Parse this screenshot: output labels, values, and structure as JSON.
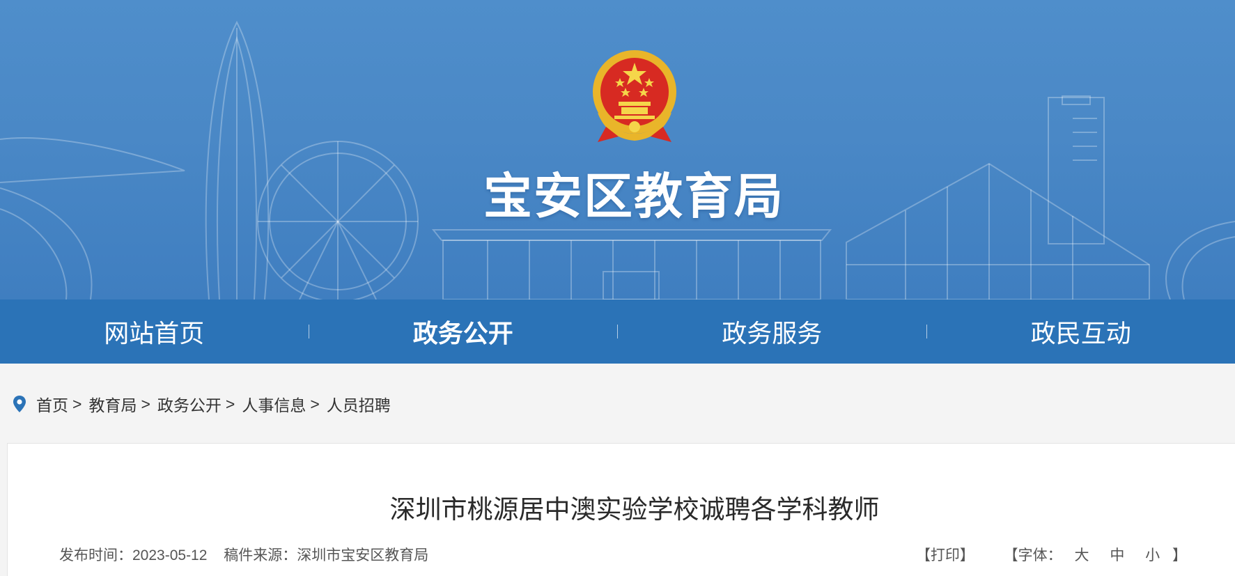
{
  "header": {
    "site_title": "宝安区教育局",
    "emblem": "national-emblem"
  },
  "nav": {
    "items": [
      {
        "label": "网站首页",
        "active": false
      },
      {
        "label": "政务公开",
        "active": true
      },
      {
        "label": "政务服务",
        "active": false
      },
      {
        "label": "政民互动",
        "active": false
      }
    ]
  },
  "breadcrumb": {
    "icon": "location-pin-icon",
    "items": [
      "首页",
      "教育局",
      "政务公开",
      "人事信息",
      "人员招聘"
    ],
    "separator": ">"
  },
  "article": {
    "title": "深圳市桃源居中澳实验学校诚聘各学科教师",
    "publish_label": "发布时间：",
    "publish_date": "2023-05-12",
    "source_label": "稿件来源：",
    "source": "深圳市宝安区教育局",
    "print_label": "【打印】",
    "font_open": "【字体：",
    "font_large": "大",
    "font_medium": "中",
    "font_small": "小",
    "font_close": "】"
  },
  "colors": {
    "banner": "#4a88c6",
    "nav": "#2b73b7",
    "page_bg": "#f4f4f4"
  }
}
